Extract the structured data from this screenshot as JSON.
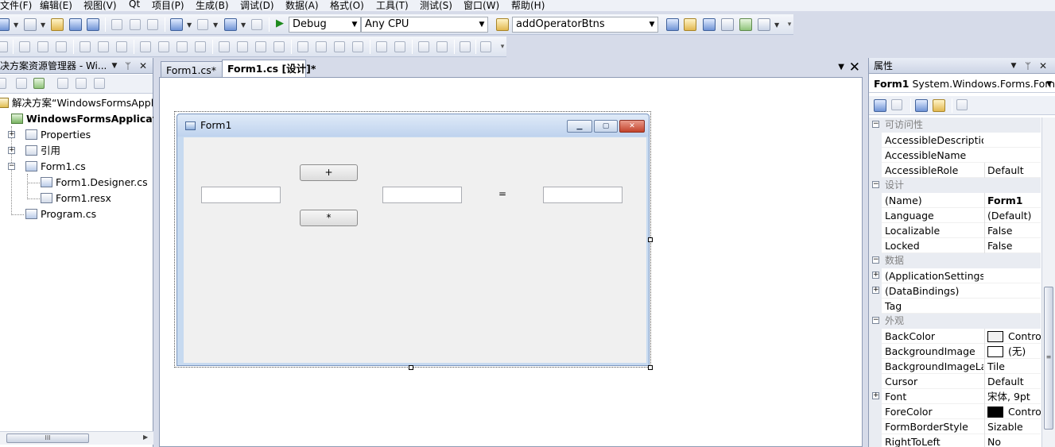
{
  "menubar": {
    "items": [
      {
        "label": "文件(F)"
      },
      {
        "label": "编辑(E)"
      },
      {
        "label": "视图(V)"
      },
      {
        "label": "Qt"
      },
      {
        "label": "项目(P)"
      },
      {
        "label": "生成(B)"
      },
      {
        "label": "调试(D)"
      },
      {
        "label": "数据(A)"
      },
      {
        "label": "格式(O)"
      },
      {
        "label": "工具(T)"
      },
      {
        "label": "测试(S)"
      },
      {
        "label": "窗口(W)"
      },
      {
        "label": "帮助(H)"
      }
    ]
  },
  "toolbar": {
    "config_value": "Debug",
    "platform_value": "Any CPU",
    "find_value": "addOperatorBtns"
  },
  "solution_explorer": {
    "title": "决方案资源管理器 - Wi...",
    "solution_label": "解决方案“WindowsFormsAppl",
    "project_label": "WindowsFormsApplicatio",
    "items": {
      "properties": "Properties",
      "references": "引用",
      "form1_cs": "Form1.cs",
      "form1_designer": "Form1.Designer.cs",
      "form1_resx": "Form1.resx",
      "program_cs": "Program.cs"
    },
    "scroll_thumb_glyph": "III"
  },
  "document": {
    "tabs": [
      {
        "label": "Form1.cs*",
        "active": false
      },
      {
        "label": "Form1.cs [设计]*",
        "active": true
      }
    ]
  },
  "form": {
    "title": "Form1",
    "btn_plus": "+",
    "btn_multiply": "*",
    "equals_label": "=",
    "textboxes": [
      "",
      "",
      ""
    ]
  },
  "properties": {
    "title": "属性",
    "object_name": "Form1",
    "object_type": " System.Windows.Forms.Forn",
    "categories": [
      {
        "name": "可访问性",
        "rows": [
          {
            "name": "AccessibleDescription",
            "value": ""
          },
          {
            "name": "AccessibleName",
            "value": ""
          },
          {
            "name": "AccessibleRole",
            "value": "Default"
          }
        ]
      },
      {
        "name": "设计",
        "rows": [
          {
            "name": "(Name)",
            "value": "Form1",
            "bold": true
          },
          {
            "name": "Language",
            "value": "(Default)"
          },
          {
            "name": "Localizable",
            "value": "False"
          },
          {
            "name": "Locked",
            "value": "False"
          }
        ]
      },
      {
        "name": "数据",
        "rows": [
          {
            "name": "(ApplicationSettings)",
            "value": "",
            "expandable": true
          },
          {
            "name": "(DataBindings)",
            "value": "",
            "expandable": true
          },
          {
            "name": "Tag",
            "value": ""
          }
        ]
      },
      {
        "name": "外观",
        "rows": [
          {
            "name": "BackColor",
            "value": "Contro",
            "swatch": "#f0f0f0"
          },
          {
            "name": "BackgroundImage",
            "value": "(无)",
            "swatch": "#ffffff"
          },
          {
            "name": "BackgroundImageLa",
            "value": "Tile"
          },
          {
            "name": "Cursor",
            "value": "Default"
          },
          {
            "name": "Font",
            "value": "宋体, 9pt",
            "expandable": true
          },
          {
            "name": "ForeColor",
            "value": "Contro",
            "swatch": "#000000"
          },
          {
            "name": "FormBorderStyle",
            "value": "Sizable"
          },
          {
            "name": "RightToLeft",
            "value": "No"
          }
        ]
      }
    ]
  },
  "colors": {
    "chrome_bg": "#d6dbe9",
    "form_client": "#f0f0f0",
    "close_button": "#c3432b"
  }
}
